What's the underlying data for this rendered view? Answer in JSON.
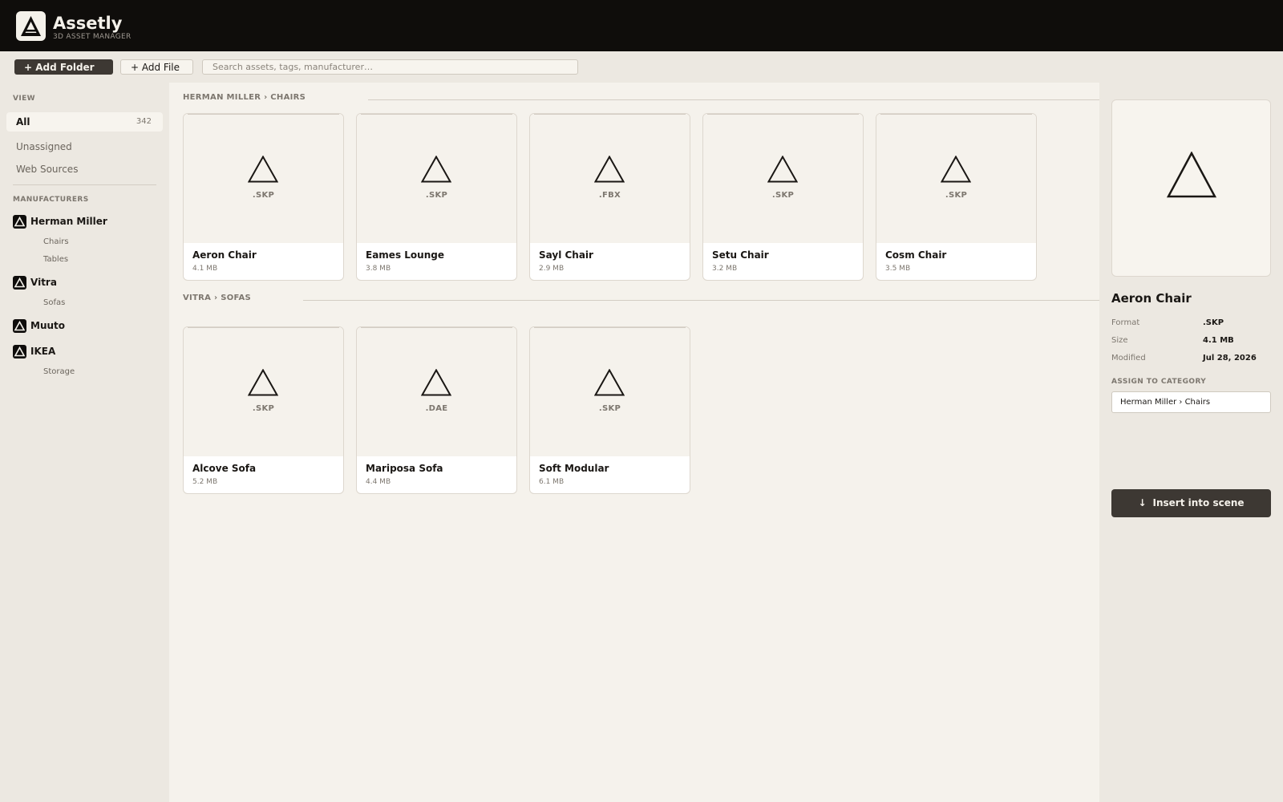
{
  "app": {
    "title": "Assetly",
    "subtitle": "3D ASSET MANAGER"
  },
  "toolbar": {
    "add_folder_label": "+ Add Folder",
    "add_file_label": "+ Add File",
    "search_placeholder": "Search assets, tags, manufacturer…"
  },
  "sidebar": {
    "view_label": "VIEW",
    "view_all": {
      "label": "All",
      "count": "342"
    },
    "view_items": [
      "Unassigned",
      "Web Sources"
    ],
    "manufacturers_label": "MANUFACTURERS",
    "manufacturers": [
      {
        "name": "Herman Miller",
        "subs": [
          "Chairs",
          "Tables"
        ]
      },
      {
        "name": "Vitra",
        "subs": [
          "Sofas"
        ]
      },
      {
        "name": "Muuto",
        "subs": []
      },
      {
        "name": "IKEA",
        "subs": [
          "Storage"
        ]
      }
    ]
  },
  "main": {
    "sections": [
      {
        "title": "HERMAN MILLER › CHAIRS",
        "cards": [
          {
            "format": ".SKP",
            "name": "Aeron Chair",
            "size": "4.1 MB"
          },
          {
            "format": ".SKP",
            "name": "Eames Lounge",
            "size": "3.8 MB"
          },
          {
            "format": ".FBX",
            "name": "Sayl Chair",
            "size": "2.9 MB"
          },
          {
            "format": ".SKP",
            "name": "Setu Chair",
            "size": "3.2 MB"
          },
          {
            "format": ".SKP",
            "name": "Cosm Chair",
            "size": "3.5 MB"
          }
        ]
      },
      {
        "title": "VITRA › SOFAS",
        "cards": [
          {
            "format": ".SKP",
            "name": "Alcove Sofa",
            "size": "5.2 MB"
          },
          {
            "format": ".DAE",
            "name": "Mariposa Sofa",
            "size": "4.4 MB"
          },
          {
            "format": ".SKP",
            "name": "Soft Modular",
            "size": "6.1 MB"
          }
        ]
      }
    ]
  },
  "detail": {
    "title": "Aeron Chair",
    "meta": [
      {
        "key": "Format",
        "value": ".SKP"
      },
      {
        "key": "Size",
        "value": "4.1 MB"
      },
      {
        "key": "Modified",
        "value": "Jul 28, 2026"
      }
    ],
    "assign_label": "ASSIGN TO CATEGORY",
    "assign_value": "Herman Miller › Chairs",
    "insert_arrow": "↓",
    "insert_label": "Insert into scene"
  },
  "colors": {
    "header_bg": "#0f0d0b",
    "page_bg": "#ece8e1",
    "main_bg": "#f5f2ec",
    "accent_dark": "#3d3833",
    "muted_text": "#7d776f"
  },
  "icons": {
    "logo": "triangle-logo-icon",
    "manufacturer": "triangle-brand-icon",
    "thumbnail": "triangle-model-icon"
  }
}
